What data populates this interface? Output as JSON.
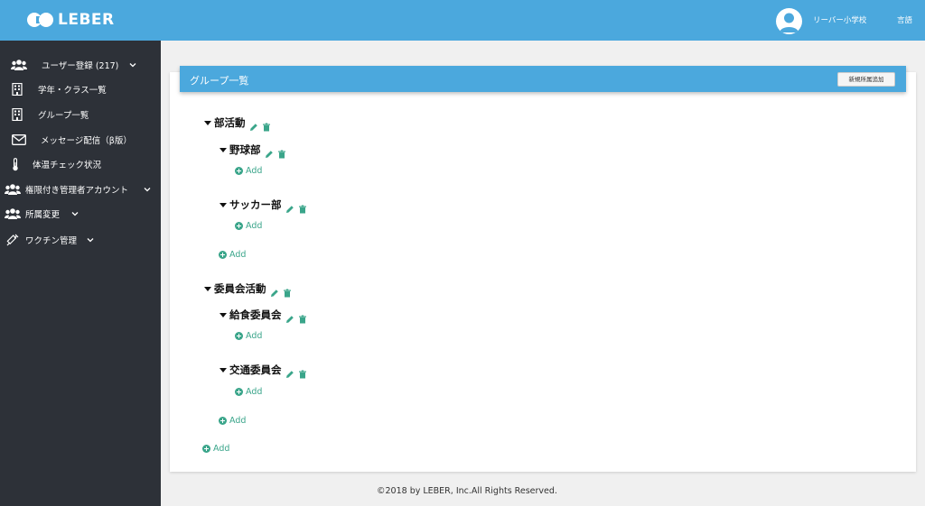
{
  "header": {
    "logo_text": "LEBER",
    "school_name": "リーバー小学校",
    "language_label": "言語"
  },
  "sidebar": {
    "items": [
      {
        "label": "ユーザー登録 (217)",
        "icon": "users-icon",
        "has_chevron": true
      },
      {
        "label": "学年・クラス一覧",
        "icon": "building-icon",
        "has_chevron": false
      },
      {
        "label": "グループ一覧",
        "icon": "building-icon",
        "has_chevron": false
      },
      {
        "label": "メッセージ配信（β版）",
        "icon": "envelope-icon",
        "has_chevron": false
      },
      {
        "label": "体温チェック状況",
        "icon": "thermometer-icon",
        "has_chevron": false
      },
      {
        "label": "権限付き管理者アカウント",
        "icon": "users-icon",
        "has_chevron": true
      },
      {
        "label": "所属変更",
        "icon": "users-icon",
        "has_chevron": true
      },
      {
        "label": "ワクチン管理",
        "icon": "syringe-icon",
        "has_chevron": true
      }
    ]
  },
  "main": {
    "title": "グループ一覧",
    "new_button_label": "新規所属追加",
    "add_label": "Add",
    "groups": [
      {
        "name": "部活動",
        "children": [
          {
            "name": "野球部"
          },
          {
            "name": "サッカー部"
          }
        ]
      },
      {
        "name": "委員会活動",
        "children": [
          {
            "name": "給食委員会"
          },
          {
            "name": "交通委員会"
          }
        ]
      }
    ]
  },
  "footer": {
    "copyright": "©2018 by LEBER, Inc.All Rights Reserved."
  },
  "colors": {
    "header_bg": "#4ba8dd",
    "sidebar_bg": "#2d3138",
    "add_green": "#3aa58a",
    "page_bg": "#f0f0f0"
  }
}
